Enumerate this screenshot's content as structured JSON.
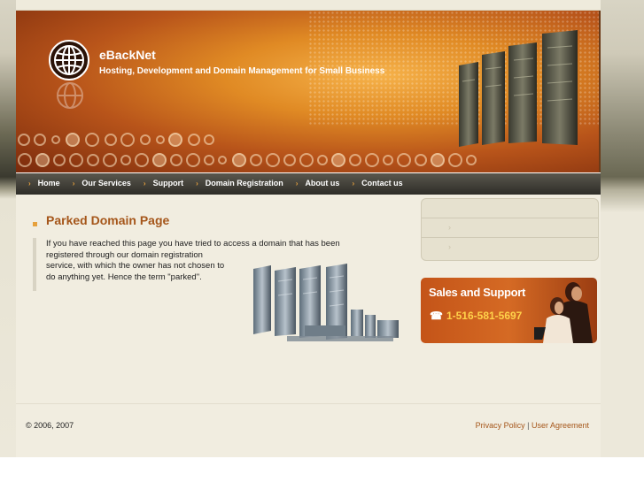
{
  "header": {
    "site_name": "eBackNet",
    "tagline": "Hosting, Development and Domain Management for Small Business"
  },
  "nav": {
    "items": [
      "Home",
      "Our Services",
      "Support",
      "Domain Registration",
      "About us",
      "Contact us"
    ],
    "arrow": "›"
  },
  "main": {
    "title": "Parked Domain Page",
    "text_lines": [
      "If you have reached this page you have tried to access a domain that has been",
      "registered through our domain registration",
      "service, with which the owner has not chosen to",
      "do anything yet. Hence the term \"parked\"."
    ]
  },
  "sidebar": {
    "menu_arrows": [
      "›",
      "›"
    ],
    "sales_title": "Sales and Support",
    "phone_icon": "☎",
    "phone": "1-516-581-5697"
  },
  "footer": {
    "copyright": "© 2006, 2007",
    "privacy": "Privacy Policy",
    "separator": " | ",
    "agreement": "User Agreement"
  },
  "colors": {
    "accent": "#a5561a",
    "nav_bg": "#2e2d28",
    "phone": "#ffd24a"
  }
}
